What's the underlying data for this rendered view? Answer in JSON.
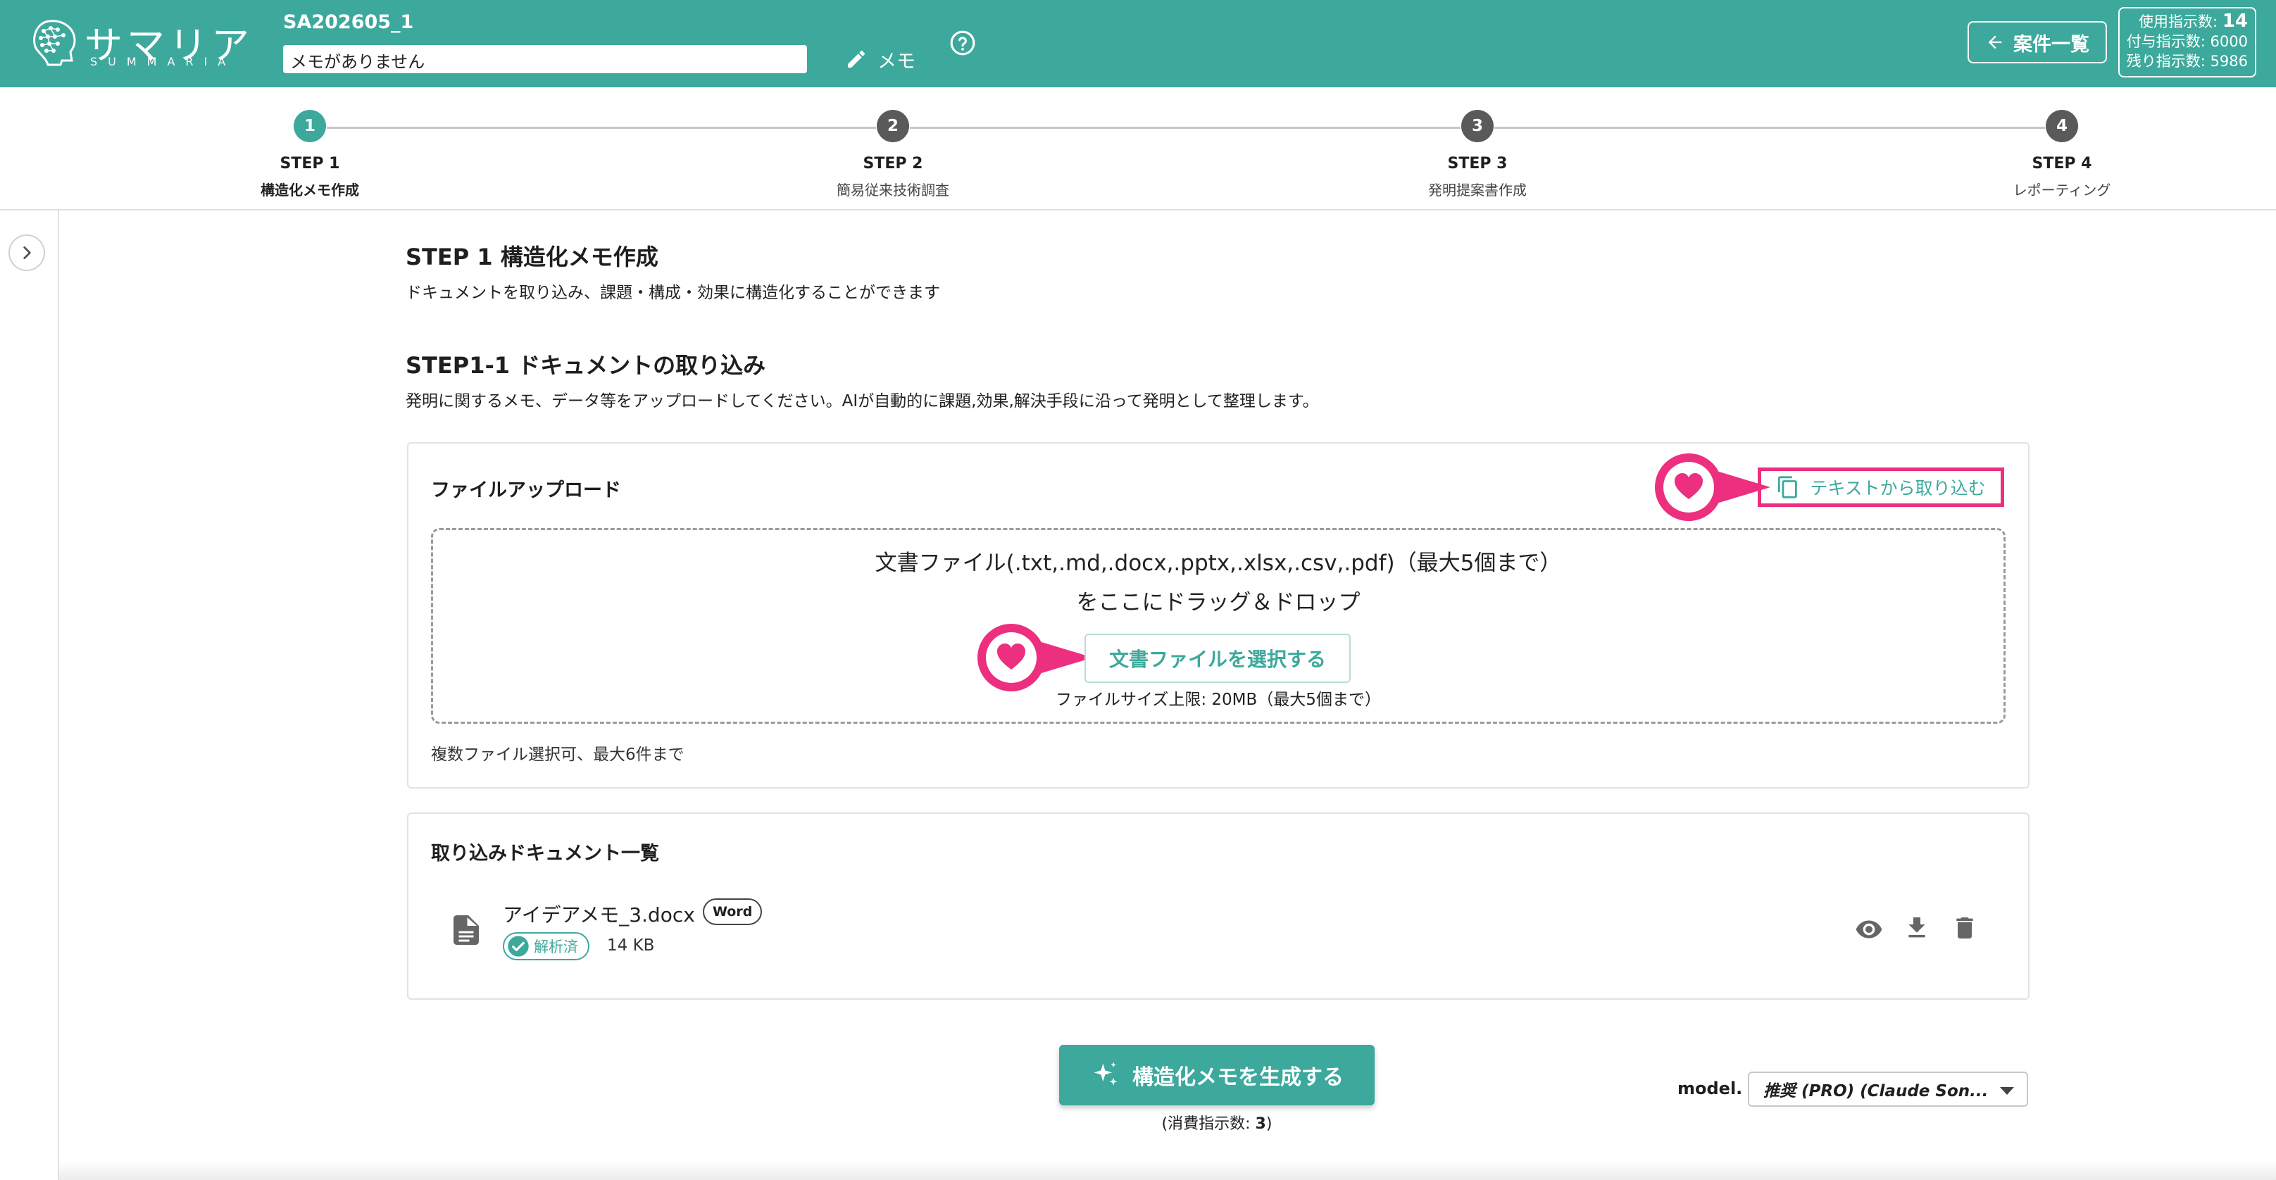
{
  "header": {
    "logo_jp": "サマリア",
    "logo_en": "SUMMARIA",
    "case_id": "SA202605_1",
    "memo_value": "メモがありません",
    "memo_button": "メモ",
    "list_button": "案件一覧",
    "usage": {
      "used_label": "使用指示数:",
      "used_value": "14",
      "granted_label": "付与指示数:",
      "granted_value": "6000",
      "remaining_label": "残り指示数:",
      "remaining_value": "5986"
    }
  },
  "steps": [
    {
      "number": "1",
      "label": "STEP 1",
      "sub": "構造化メモ作成",
      "active": true
    },
    {
      "number": "2",
      "label": "STEP 2",
      "sub": "簡易従来技術調査",
      "active": false
    },
    {
      "number": "3",
      "label": "STEP 3",
      "sub": "発明提案書作成",
      "active": false
    },
    {
      "number": "4",
      "label": "STEP 4",
      "sub": "レポーティング",
      "active": false
    }
  ],
  "main": {
    "title": "STEP 1 構造化メモ作成",
    "description": "ドキュメントを取り込み、課題・構成・効果に構造化することができます",
    "section_title": "STEP1-1 ドキュメントの取り込み",
    "section_description": "発明に関するメモ、データ等をアップロードしてください。AIが自動的に課題,効果,解決手段に沿って発明として整理します。"
  },
  "upload": {
    "title": "ファイルアップロード",
    "text_import_button": "テキストから取り込む",
    "drop_line1": "文書ファイル(.txt,.md,.docx,.pptx,.xlsx,.csv,.pdf)（最大5個まで）",
    "drop_line2": "をここにドラッグ＆ドロップ",
    "select_button": "文書ファイルを選択する",
    "size_limit": "ファイルサイズ上限: 20MB（最大5個まで）",
    "multi_note": "複数ファイル選択可、最大6件まで"
  },
  "documents": {
    "title": "取り込みドキュメント一覧",
    "items": [
      {
        "name": "アイデアメモ_3.docx",
        "type": "Word",
        "status": "解析済",
        "size": "14 KB"
      }
    ]
  },
  "footer": {
    "generate_button": "構造化メモを生成する",
    "consume_prefix": "(消費指示数: ",
    "consume_value": "3",
    "consume_suffix": ")",
    "model_label": "model.",
    "model_value": "推奨 (PRO) (Claude Son..."
  },
  "colors": {
    "brand": "#3ca99c",
    "highlight": "#ec2f7e"
  }
}
